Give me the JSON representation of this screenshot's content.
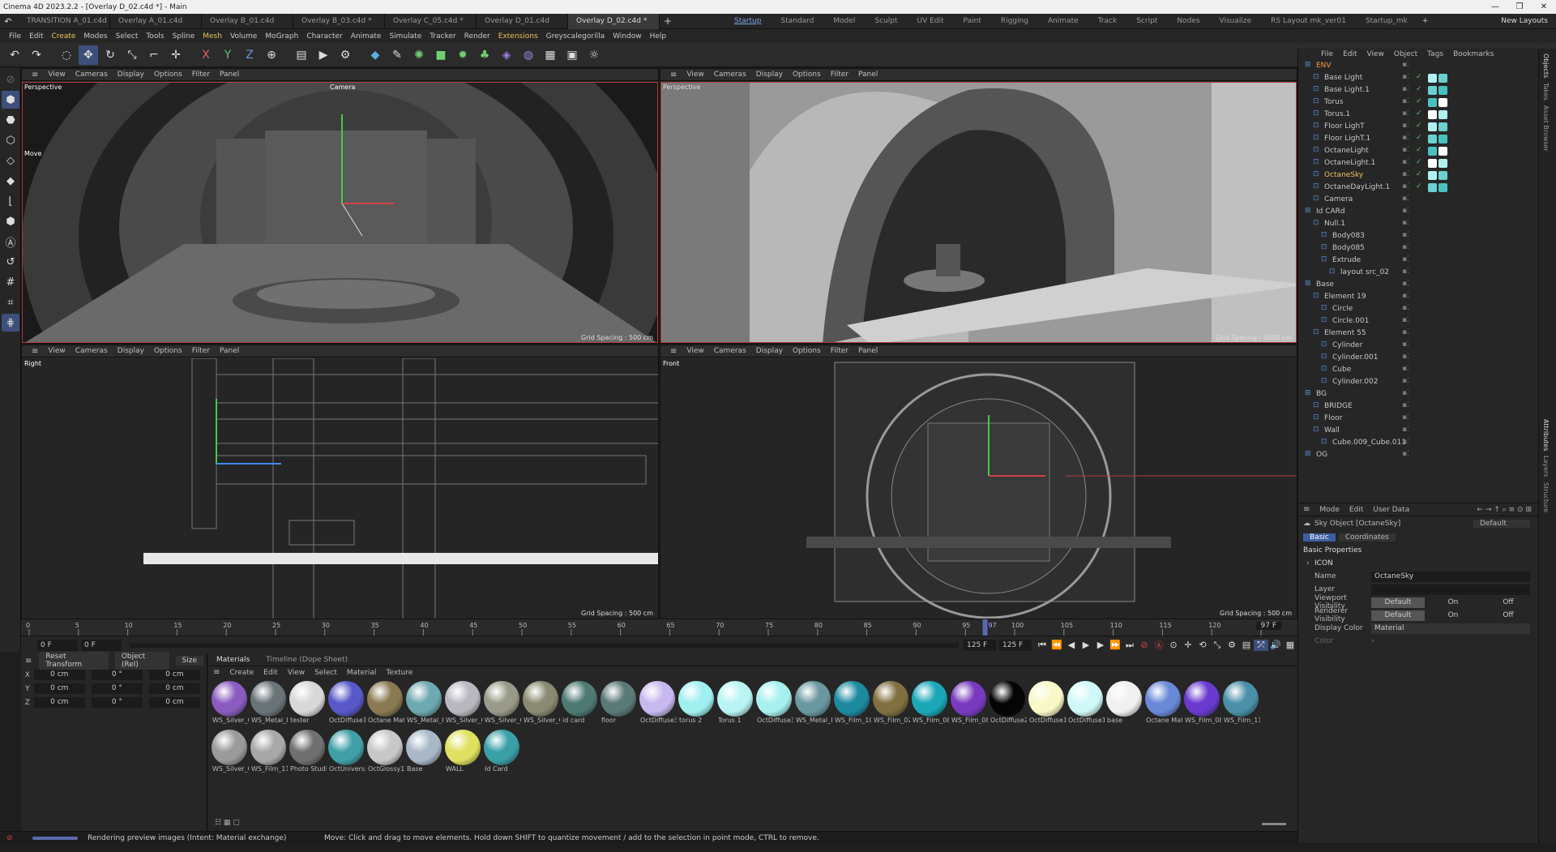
{
  "title": "Cinema 4D 2023.2.2 - [Overlay D_02.c4d *] - Main",
  "doc_tabs": [
    "TRANSITION A_01.c4d *",
    "Overlay A_01.c4d",
    "Overlay B_01.c4d",
    "Overlay B_03.c4d *",
    "Overlay C_05.c4d *",
    "Overlay D_01.c4d",
    "Overlay D_02.c4d *"
  ],
  "layout_tabs": [
    "Startup",
    "Standard",
    "Model",
    "Sculpt",
    "UV Edit",
    "Paint",
    "Rigging",
    "Animate",
    "Track",
    "Script",
    "Nodes",
    "Visualize",
    "RS Layout mk_ver01",
    "Startup_mk"
  ],
  "new_layouts": "New Layouts",
  "menu": [
    "File",
    "Edit",
    "Create",
    "Modes",
    "Select",
    "Tools",
    "Spline",
    "Mesh",
    "Volume",
    "MoGraph",
    "Character",
    "Animate",
    "Simulate",
    "Tracker",
    "Render",
    "Extensions",
    "Greyscalegorilla",
    "Window",
    "Help"
  ],
  "viewports": {
    "menu": [
      "View",
      "Cameras",
      "Display",
      "Options",
      "Filter",
      "Panel"
    ],
    "tl": {
      "name": "Perspective",
      "cam": "Camera",
      "move": "Move",
      "grid": "Grid Spacing : 500 cm"
    },
    "tr": {
      "name": "Perspective",
      "grid": "Grid Spacing : 5000 cm"
    },
    "bl": {
      "name": "Right",
      "grid": "Grid Spacing : 500 cm"
    },
    "br": {
      "name": "Front",
      "grid": "Grid Spacing : 500 cm"
    }
  },
  "timeline": {
    "ticks": [
      "0",
      "5",
      "10",
      "15",
      "20",
      "25",
      "30",
      "35",
      "40",
      "45",
      "50",
      "55",
      "60",
      "65",
      "70",
      "75",
      "80",
      "85",
      "90",
      "95",
      "100",
      "105",
      "110",
      "115",
      "120",
      "125"
    ],
    "current": "97",
    "end_label": "97 F",
    "start": "0 F",
    "min": "0 F",
    "max": "125 F",
    "end": "125 F"
  },
  "coords": {
    "reset": "Reset Transform",
    "mode": "Object (Rel)",
    "size": "Size",
    "rows": [
      {
        "ax": "X",
        "p": "0 cm",
        "r": "0 °",
        "s": "0 cm"
      },
      {
        "ax": "Y",
        "p": "0 cm",
        "r": "0 °",
        "s": "0 cm"
      },
      {
        "ax": "Z",
        "p": "0 cm",
        "r": "0 °",
        "s": "0 cm"
      }
    ]
  },
  "materials": {
    "tabs": [
      "Materials",
      "Timeline (Dope Sheet)"
    ],
    "menu": [
      "Create",
      "Edit",
      "View",
      "Select",
      "Material",
      "Texture"
    ],
    "items": [
      {
        "name": "WS_Silver_C",
        "color": "#8a5cc0"
      },
      {
        "name": "WS_Metal_I",
        "color": "#6a7478"
      },
      {
        "name": "tester",
        "color": "#d8d8d8"
      },
      {
        "name": "OctDiffuse1",
        "color": "#5858c8"
      },
      {
        "name": "Octane Mat",
        "color": "#8a7a52"
      },
      {
        "name": "WS_Metal_I",
        "color": "#6ea8b0"
      },
      {
        "name": "WS_Silver_C",
        "color": "#b8b8c0"
      },
      {
        "name": "WS_Silver_C",
        "color": "#9a9a8a"
      },
      {
        "name": "WS_Silver_C",
        "color": "#8a8a72"
      },
      {
        "name": "id card",
        "color": "#4f7a74"
      },
      {
        "name": "floor",
        "color": "#5a7a78"
      },
      {
        "name": "OctDiffuse3",
        "color": "#c8b8f0"
      },
      {
        "name": "torus 2",
        "color": "#a0f0f0"
      },
      {
        "name": "Torus 1",
        "color": "#b8f4f4"
      },
      {
        "name": "OctDiffuse3",
        "color": "#a8f0f0"
      },
      {
        "name": "WS_Metal_I",
        "color": "#6a98a0"
      },
      {
        "name": "WS_Film_10",
        "color": "#1e8aa0"
      },
      {
        "name": "WS_Film_02",
        "color": "#807040"
      },
      {
        "name": "WS_Film_08",
        "color": "#1aa8b8"
      },
      {
        "name": "WS_Film_08",
        "color": "#7a3ac0"
      },
      {
        "name": "OctDiffuse2",
        "color": "#050505"
      },
      {
        "name": "OctDiffuse1",
        "color": "#f8f8c8"
      },
      {
        "name": "OctDiffuse1",
        "color": "#d0f8f8"
      },
      {
        "name": "base",
        "color": "#f0f0f0"
      },
      {
        "name": "Octane Mat",
        "color": "#6a88d8"
      },
      {
        "name": "WS_Film_08",
        "color": "#6a3ad0"
      },
      {
        "name": "WS_Film_11",
        "color": "#4a90a8"
      },
      {
        "name": "WS_Silver_C",
        "color": "#9a9a9a"
      },
      {
        "name": "WS_Film_11",
        "color": "#a8a8a8"
      },
      {
        "name": "Photo Studi",
        "color": "#707070"
      },
      {
        "name": "OctUniversa",
        "color": "#40a0a8"
      },
      {
        "name": "OctGlossy1",
        "color": "#c8c8c8"
      },
      {
        "name": "Base",
        "color": "#a8b8c8"
      },
      {
        "name": "WALL",
        "color": "#e0e060"
      },
      {
        "name": "Id Card",
        "color": "#3aa0a8"
      }
    ]
  },
  "objects": {
    "menu": [
      "File",
      "Edit",
      "View",
      "Object",
      "Tags",
      "Bookmarks"
    ],
    "rows": [
      {
        "name": "ENV",
        "indent": 0,
        "orange": true
      },
      {
        "name": "Base Light",
        "indent": 1
      },
      {
        "name": "Base Light.1",
        "indent": 1
      },
      {
        "name": "Torus",
        "indent": 1
      },
      {
        "name": "Torus.1",
        "indent": 1
      },
      {
        "name": "Floor LighT",
        "indent": 1
      },
      {
        "name": "Floor LighT.1",
        "indent": 1
      },
      {
        "name": "OctaneLight",
        "indent": 1
      },
      {
        "name": "OctaneLight.1",
        "indent": 1
      },
      {
        "name": "OctaneSky",
        "indent": 1,
        "sel": true
      },
      {
        "name": "OctaneDayLight.1",
        "indent": 1
      },
      {
        "name": "Camera",
        "indent": 1
      },
      {
        "name": "Id CARd",
        "indent": 0
      },
      {
        "name": "Null.1",
        "indent": 1
      },
      {
        "name": "Body083",
        "indent": 2
      },
      {
        "name": "Body085",
        "indent": 2
      },
      {
        "name": "Extrude",
        "indent": 2
      },
      {
        "name": "layout src_02",
        "indent": 3
      },
      {
        "name": "Base",
        "indent": 0
      },
      {
        "name": "Element 19",
        "indent": 1
      },
      {
        "name": "Circle",
        "indent": 2
      },
      {
        "name": "Circle.001",
        "indent": 2
      },
      {
        "name": "Element 55",
        "indent": 1
      },
      {
        "name": "Cylinder",
        "indent": 2
      },
      {
        "name": "Cylinder.001",
        "indent": 2
      },
      {
        "name": "Cube",
        "indent": 2
      },
      {
        "name": "Cylinder.002",
        "indent": 2
      },
      {
        "name": "BG",
        "indent": 0
      },
      {
        "name": "BRIDGE",
        "indent": 1
      },
      {
        "name": "Floor",
        "indent": 1
      },
      {
        "name": "Wall",
        "indent": 1
      },
      {
        "name": "Cube.009_Cube.011",
        "indent": 2
      },
      {
        "name": "OG",
        "indent": 0
      }
    ]
  },
  "attributes": {
    "menu": [
      "Mode",
      "Edit",
      "User Data"
    ],
    "object": "Sky Object [OctaneSky]",
    "preset": "Default",
    "tabs": [
      "Basic",
      "Coordinates"
    ],
    "section": "Basic Properties",
    "icon_label": "ICON",
    "name_label": "Name",
    "name_value": "OctaneSky",
    "layer_label": "Layer",
    "viewport_label": "Viewport Visibility",
    "renderer_label": "Renderer Visibility",
    "vis_opts": [
      "Default",
      "On",
      "Off"
    ],
    "display_color_label": "Display Color",
    "display_color_value": "Material",
    "color_label": "Color"
  },
  "side_tabs": [
    "Objects",
    "Takes",
    "Asset Browser",
    "Attributes",
    "Layers",
    "Structure"
  ],
  "status": {
    "left": "Rendering preview images (Intent: Material exchange)",
    "right": "Move: Click and drag to move elements. Hold down SHIFT to quantize movement / add to the selection in point mode, CTRL to remove."
  }
}
